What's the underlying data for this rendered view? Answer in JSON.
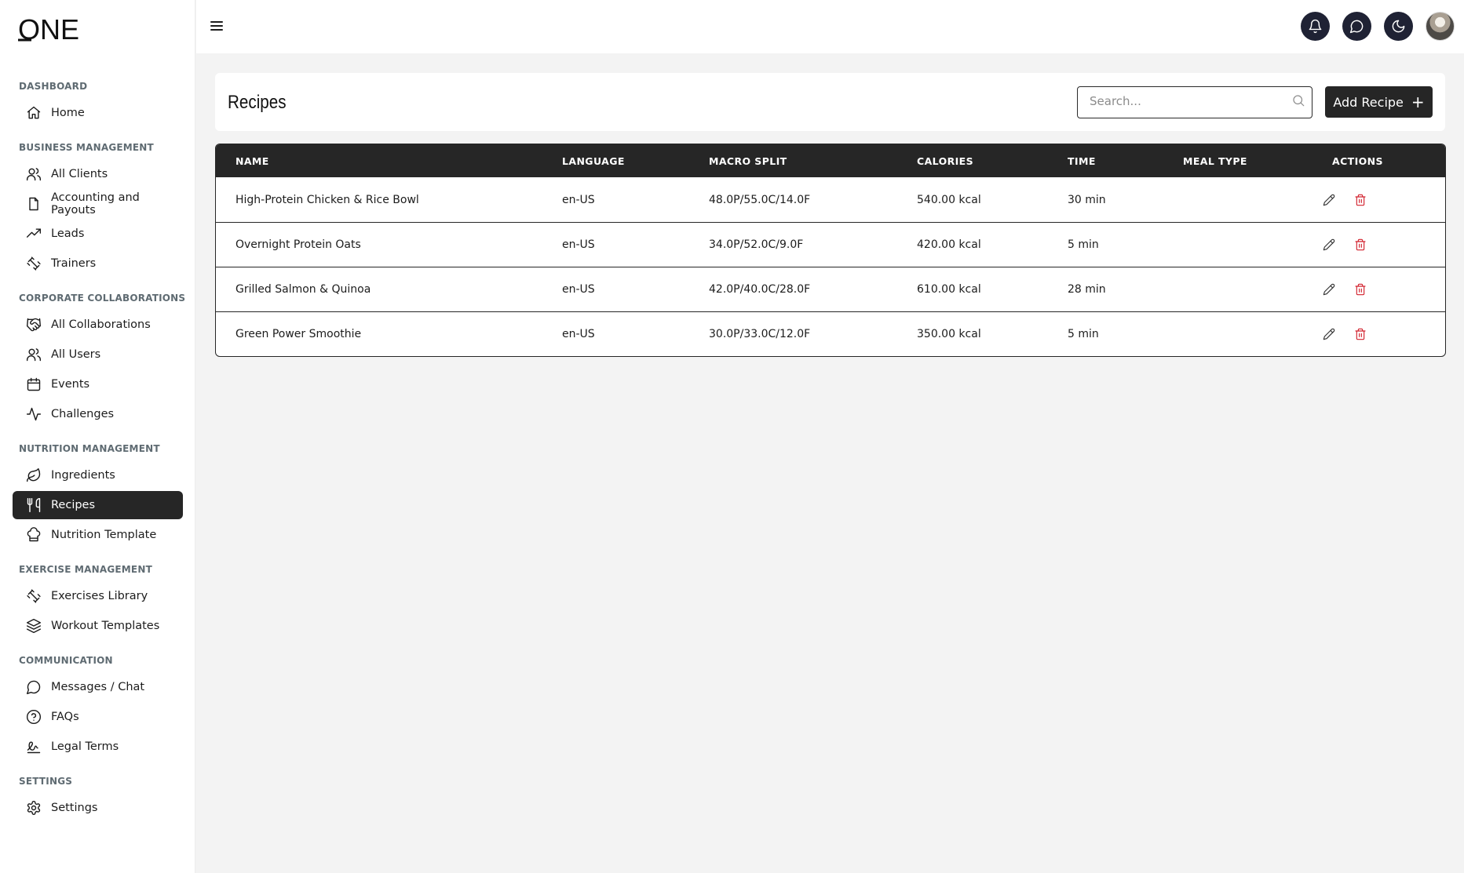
{
  "brand": {
    "logo_text": "ONE"
  },
  "sidebar": {
    "sections": [
      {
        "title": "DASHBOARD",
        "items": [
          {
            "label": "Home",
            "icon": "home-icon"
          }
        ]
      },
      {
        "title": "BUSINESS MANAGEMENT",
        "items": [
          {
            "label": "All Clients",
            "icon": "users-icon"
          },
          {
            "label": "Accounting and Payouts",
            "icon": "file-icon"
          },
          {
            "label": "Leads",
            "icon": "trending-up-icon"
          },
          {
            "label": "Trainers",
            "icon": "dumbbell-icon"
          }
        ]
      },
      {
        "title": "CORPORATE COLLABORATIONS",
        "items": [
          {
            "label": "All Collaborations",
            "icon": "handshake-icon"
          },
          {
            "label": "All Users",
            "icon": "users-icon"
          },
          {
            "label": "Events",
            "icon": "calendar-icon"
          },
          {
            "label": "Challenges",
            "icon": "activity-icon"
          }
        ]
      },
      {
        "title": "NUTRITION MANAGEMENT",
        "items": [
          {
            "label": "Ingredients",
            "icon": "leaf-icon"
          },
          {
            "label": "Recipes",
            "icon": "utensils-icon",
            "active": true
          },
          {
            "label": "Nutrition Template",
            "icon": "chef-hat-icon"
          }
        ]
      },
      {
        "title": "EXERCISE MANAGEMENT",
        "items": [
          {
            "label": "Exercises Library",
            "icon": "dumbbell-icon"
          },
          {
            "label": "Workout Templates",
            "icon": "layers-icon"
          }
        ]
      },
      {
        "title": "COMMUNICATION",
        "items": [
          {
            "label": "Messages / Chat",
            "icon": "message-circle-icon"
          },
          {
            "label": "FAQs",
            "icon": "help-circle-icon"
          },
          {
            "label": "Legal Terms",
            "icon": "signature-icon"
          }
        ]
      },
      {
        "title": "SETTINGS",
        "items": [
          {
            "label": "Settings",
            "icon": "gear-icon"
          }
        ]
      }
    ]
  },
  "topbar": {
    "icons": [
      "bell-icon",
      "chat-icon",
      "moon-icon"
    ]
  },
  "header": {
    "title": "Recipes",
    "search_placeholder": "Search...",
    "search_value": "",
    "add_label": "Add Recipe"
  },
  "table": {
    "columns": [
      "NAME",
      "LANGUAGE",
      "MACRO SPLIT",
      "CALORIES",
      "TIME",
      "MEAL TYPE",
      "ACTIONS"
    ],
    "rows": [
      {
        "name": "High-Protein Chicken & Rice Bowl",
        "language": "en-US",
        "macro": "48.0P/55.0C/14.0F",
        "calories": "540.00 kcal",
        "time": "30 min",
        "meal_type": ""
      },
      {
        "name": "Overnight Protein Oats",
        "language": "en-US",
        "macro": "34.0P/52.0C/9.0F",
        "calories": "420.00 kcal",
        "time": "5 min",
        "meal_type": ""
      },
      {
        "name": "Grilled Salmon & Quinoa",
        "language": "en-US",
        "macro": "42.0P/40.0C/28.0F",
        "calories": "610.00 kcal",
        "time": "28 min",
        "meal_type": ""
      },
      {
        "name": "Green Power Smoothie",
        "language": "en-US",
        "macro": "30.0P/33.0C/12.0F",
        "calories": "350.00 kcal",
        "time": "5 min",
        "meal_type": ""
      }
    ]
  },
  "colors": {
    "accent": "#262626",
    "danger": "#d2202c",
    "topbar_button": "#1f2234",
    "background": "#f3f3f3"
  }
}
